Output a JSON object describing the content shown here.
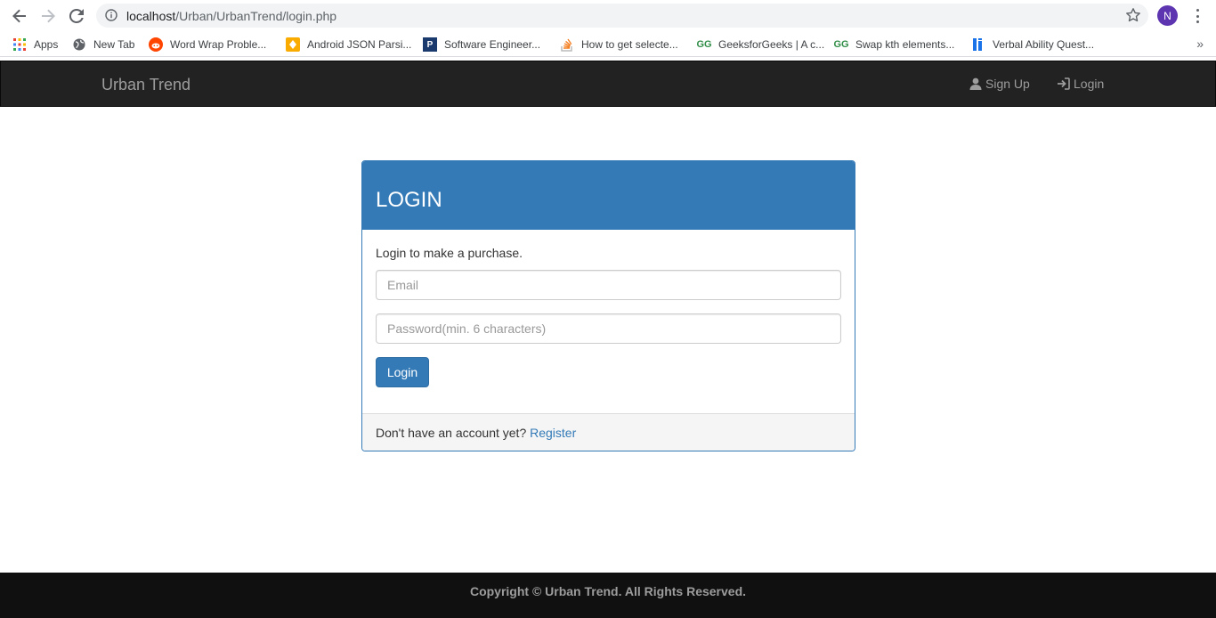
{
  "browser": {
    "url_host": "localhost",
    "url_path": "/Urban/UrbanTrend/login.php",
    "avatar_letter": "N",
    "bookmarks": [
      {
        "label": "Apps",
        "icon": "apps-grid-icon"
      },
      {
        "label": "New Tab",
        "icon": "globe-icon"
      },
      {
        "label": "Word Wrap Proble...",
        "icon": "reddit-icon"
      },
      {
        "label": "Android JSON Parsi...",
        "icon": "bookmark-yellow-icon"
      },
      {
        "label": "Software Engineer...",
        "icon": "p-icon"
      },
      {
        "label": "How to get selecte...",
        "icon": "stackoverflow-icon"
      },
      {
        "label": "GeeksforGeeks | A c...",
        "icon": "geeksforgeeks-icon"
      },
      {
        "label": "Swap kth elements...",
        "icon": "geeksforgeeks-icon"
      },
      {
        "label": "Verbal Ability Quest...",
        "icon": "indiabix-icon"
      }
    ],
    "more_label": "»"
  },
  "navbar": {
    "brand": "Urban Trend",
    "signup_label": "Sign Up",
    "login_label": "Login"
  },
  "panel": {
    "title": "LOGIN",
    "subtitle": "Login to make a purchase.",
    "email_placeholder": "Email",
    "password_placeholder": "Password(min. 6 characters)",
    "login_button": "Login",
    "footer_text": "Don't have an account yet?",
    "register_link": "Register"
  },
  "footer": {
    "copyright": "Copyright © Urban Trend. All Rights Reserved."
  },
  "colors": {
    "primary": "#337ab7",
    "navbar_bg": "#222222",
    "footer_bg": "#101010",
    "avatar": "#5e35b1"
  }
}
